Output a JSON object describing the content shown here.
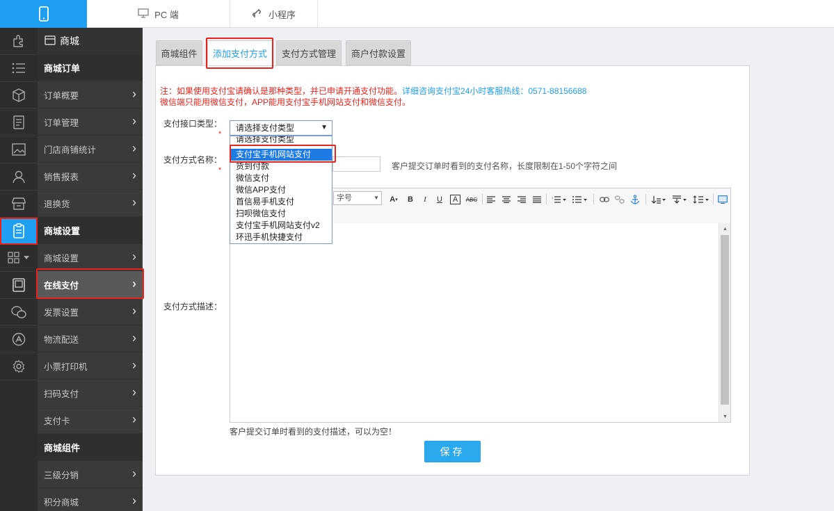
{
  "topbar": {
    "tabs": [
      {
        "label": "PC 端",
        "icon": "monitor-icon"
      },
      {
        "label": "小程序",
        "icon": "mini-program-icon"
      }
    ]
  },
  "rail": {
    "icons": [
      "puzzle-icon",
      "list-icon",
      "box-icon",
      "document-icon",
      "image-icon",
      "user-icon",
      "store-icon",
      "clipboard-icon",
      "grid-icon",
      "tablet-icon",
      "wechat-icon",
      "appstore-icon",
      "gear-icon"
    ],
    "active": "clipboard-icon"
  },
  "sidebar": {
    "header": "商城",
    "items": [
      {
        "label": "商城订单",
        "type": "section"
      },
      {
        "label": "订单概要"
      },
      {
        "label": "订单管理"
      },
      {
        "label": "门店商铺统计"
      },
      {
        "label": "销售报表"
      },
      {
        "label": "退换货"
      },
      {
        "label": "商城设置",
        "type": "section"
      },
      {
        "label": "商城设置"
      },
      {
        "label": "在线支付",
        "active": true
      },
      {
        "label": "发票设置"
      },
      {
        "label": "物流配送"
      },
      {
        "label": "小票打印机"
      },
      {
        "label": "扫码支付"
      },
      {
        "label": "支付卡"
      },
      {
        "label": "商城组件",
        "type": "section"
      },
      {
        "label": "三级分销"
      },
      {
        "label": "积分商城"
      }
    ]
  },
  "tabs": [
    {
      "label": "商城组件"
    },
    {
      "label": "添加支付方式",
      "active": true
    },
    {
      "label": "支付方式管理"
    },
    {
      "label": "商户付款设置"
    }
  ],
  "notes": {
    "line1_red": "注：如果使用支付宝请确认是那种类型，并已申请开通支付功能。",
    "line1_blue": "详细咨询支付宝24小时客服热线：0571-88156688",
    "line2": "微信端只能用微信支付，APP能用支付宝手机网站支付和微信支付。"
  },
  "form": {
    "type_label": "支付接口类型：",
    "type_value": "请选择支付类型",
    "type_options": [
      "请选择支付类型",
      "支付宝手机网站支付",
      "货到付款",
      "微信支付",
      "微信APP支付",
      "首信易手机支付",
      "扫呗微信支付",
      "支付宝手机网站支付v2",
      "环迅手机快捷支付"
    ],
    "type_highlighted": "支付宝手机网站支付",
    "name_label": "支付方式名称：",
    "name_hint": "客户提交订单时看到的支付名称，长度限制在1-50个字符之间",
    "desc_label": "支付方式描述：",
    "desc_hint": "客户提交订单时看到的支付描述，可以为空！",
    "font_size_placeholder": "字号",
    "required_mark": "*",
    "save_label": "保存"
  },
  "colors": {
    "accent": "#1e9ff2",
    "highlight_box": "#e8231a",
    "sidebar_bg": "#3a3a3a",
    "rail_bg": "#2d2d2d"
  }
}
